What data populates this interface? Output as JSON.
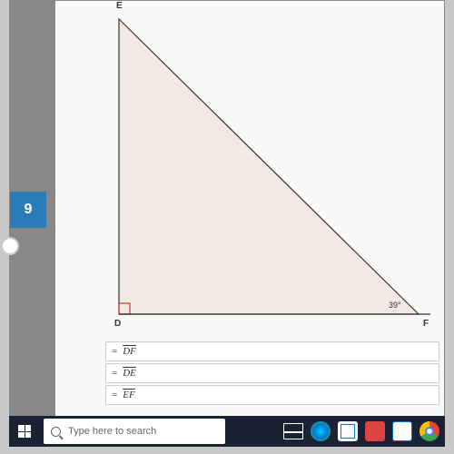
{
  "problem": {
    "number": "9",
    "vertices": {
      "E": "E",
      "D": "D",
      "F": "F"
    },
    "angle_F": "39°",
    "segments": [
      {
        "eq": "=",
        "label": "DF"
      },
      {
        "eq": "=",
        "label": "DE"
      },
      {
        "eq": "=",
        "label": "EF"
      }
    ]
  },
  "taskbar": {
    "search_placeholder": "Type here to search"
  }
}
